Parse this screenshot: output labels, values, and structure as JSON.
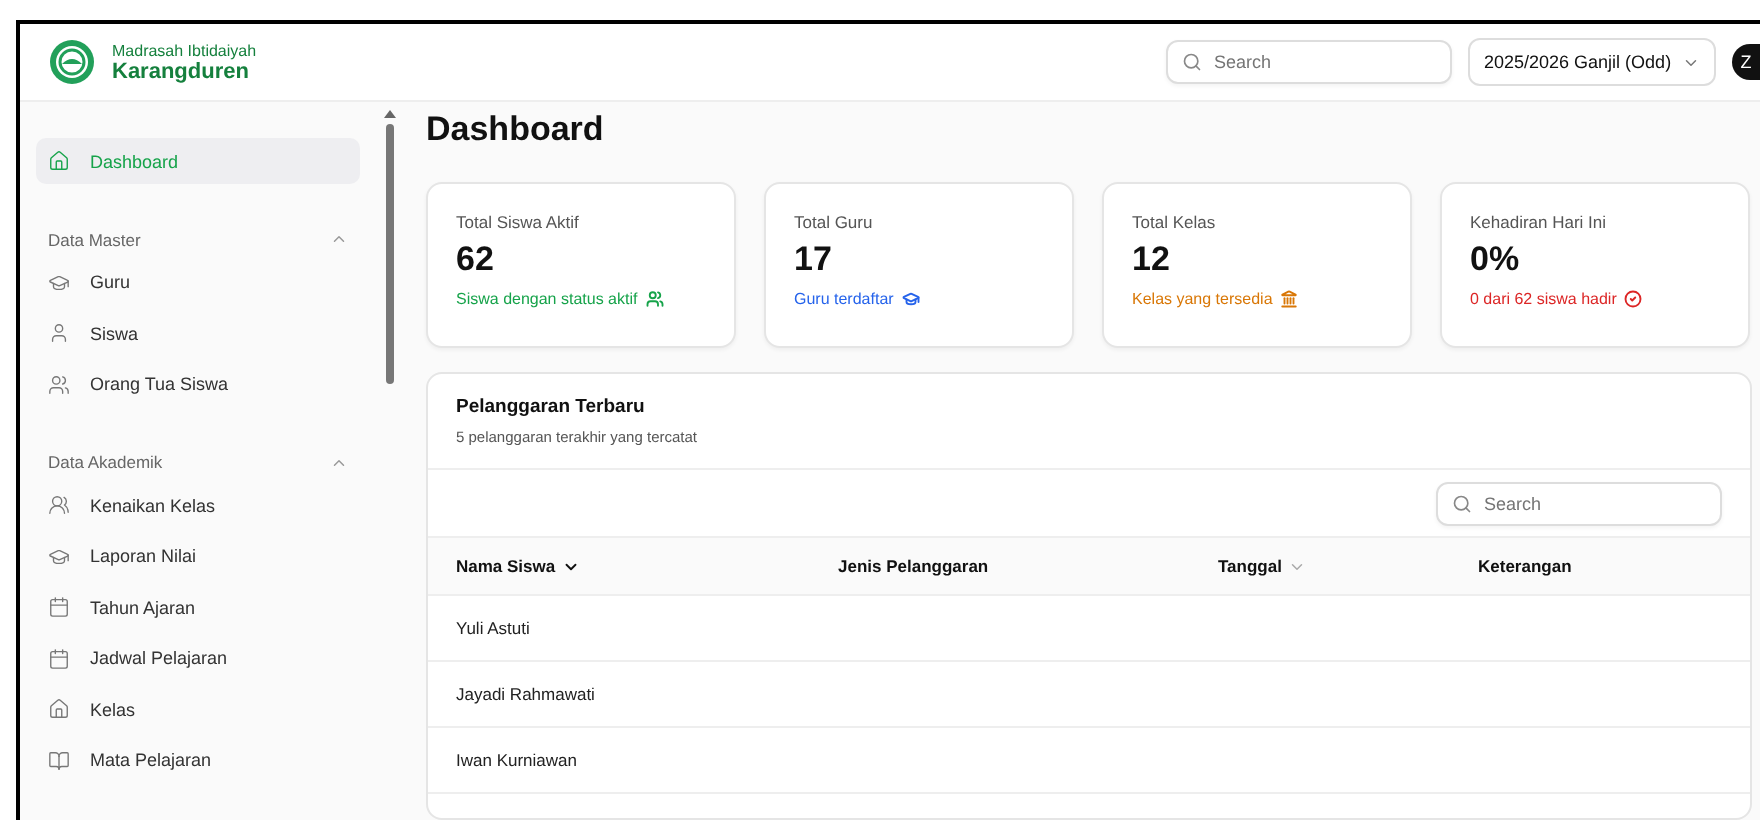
{
  "brand": {
    "line1": "Madrasah Ibtidaiyah",
    "line2": "Karangduren"
  },
  "header": {
    "search": {
      "placeholder": "Search"
    },
    "period": "2025/2026 Ganjil (Odd)",
    "avatar": "Z"
  },
  "sidebar": {
    "items": [
      {
        "label": "Dashboard",
        "selected": true
      }
    ],
    "sections": [
      {
        "title": "Data Master",
        "expanded": true,
        "items": [
          {
            "label": "Guru",
            "selected": false
          },
          {
            "label": "Siswa",
            "selected": false
          },
          {
            "label": "Orang Tua Siswa",
            "selected": false
          }
        ]
      },
      {
        "title": "Data Akademik",
        "expanded": true,
        "items": [
          {
            "label": "Kenaikan Kelas",
            "selected": false
          },
          {
            "label": "Laporan Nilai",
            "selected": false
          },
          {
            "label": "Tahun Ajaran",
            "selected": false
          },
          {
            "label": "Jadwal Pelajaran",
            "selected": false
          },
          {
            "label": "Kelas",
            "selected": false
          },
          {
            "label": "Mata Pelajaran",
            "selected": false
          }
        ]
      }
    ]
  },
  "page_title": "Dashboard",
  "stats": [
    {
      "label": "Total Siswa Aktif",
      "value": "62",
      "note": "Siswa dengan status aktif",
      "color": "#16a34a"
    },
    {
      "label": "Total Guru",
      "value": "17",
      "note": "Guru terdaftar",
      "color": "#2563eb"
    },
    {
      "label": "Total Kelas",
      "value": "12",
      "note": "Kelas yang tersedia",
      "color": "#d97706"
    },
    {
      "label": "Kehadiran Hari Ini",
      "value": "0%",
      "note": "0 dari 62 siswa hadir",
      "color": "#dc2626"
    }
  ],
  "violations": {
    "title": "Pelanggaran Terbaru",
    "subtitle": "5 pelanggaran terakhir yang tercatat",
    "search": {
      "placeholder": "Search"
    },
    "columns": [
      "Nama Siswa",
      "Jenis Pelanggaran",
      "Tanggal",
      "Keterangan"
    ],
    "rows": [
      {
        "name": "Yuli Astuti"
      },
      {
        "name": "Jayadi Rahmawati"
      },
      {
        "name": "Iwan Kurniawan"
      }
    ]
  }
}
